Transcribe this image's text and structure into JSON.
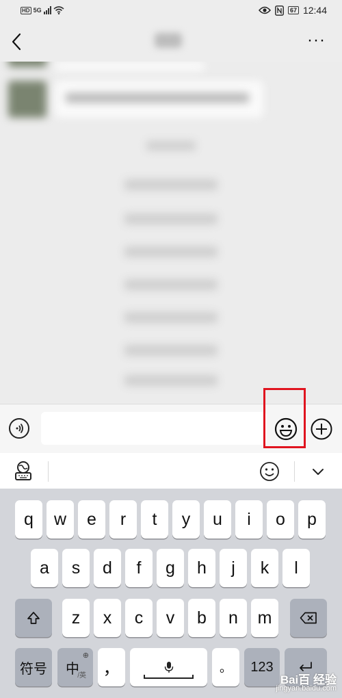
{
  "status_bar": {
    "hd": "HD",
    "network": "5G",
    "battery": "67",
    "time": "12:44"
  },
  "header": {
    "back_icon": "back-arrow-icon",
    "more_icon": "more-dots-icon"
  },
  "input_bar": {
    "voice_icon": "voice-icon",
    "input_value": "",
    "emoji_icon": "emoji-icon",
    "plus_icon": "plus-icon",
    "highlight_color": "#e0141f"
  },
  "keyboard_toolbar": {
    "keyboard_icon": "keyboard-settings-icon",
    "emoji_icon": "emoji-icon",
    "collapse_icon": "chevron-down-icon"
  },
  "keyboard": {
    "row1": [
      "q",
      "w",
      "e",
      "r",
      "t",
      "y",
      "u",
      "i",
      "o",
      "p"
    ],
    "row2": [
      "a",
      "s",
      "d",
      "f",
      "g",
      "h",
      "j",
      "k",
      "l"
    ],
    "row3": [
      "z",
      "x",
      "c",
      "v",
      "b",
      "n",
      "m"
    ],
    "shift_icon": "shift-icon",
    "backspace_icon": "backspace-icon",
    "symbols_label": "符号",
    "lang_label": "中",
    "lang_sub": "/英",
    "comma": "，",
    "period": "。",
    "num_label": "123",
    "mic_icon": "mic-icon"
  },
  "watermark": {
    "main": "Bai百 经验",
    "sub": "jingyan.baidu.com"
  }
}
